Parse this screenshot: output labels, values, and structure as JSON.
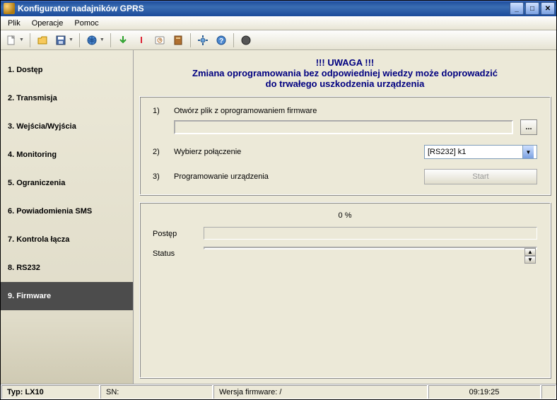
{
  "window": {
    "title": "Konfigurator nadajników GPRS"
  },
  "menu": {
    "file": "Plik",
    "operations": "Operacje",
    "help": "Pomoc"
  },
  "sidebar": {
    "items": [
      {
        "label": "1. Dostęp"
      },
      {
        "label": "2. Transmisja"
      },
      {
        "label": "3. Wejścia/Wyjścia"
      },
      {
        "label": "4. Monitoring"
      },
      {
        "label": "5. Ograniczenia"
      },
      {
        "label": "6. Powiadomienia SMS"
      },
      {
        "label": "7. Kontrola łącza"
      },
      {
        "label": "8. RS232"
      },
      {
        "label": "9. Firmware"
      }
    ],
    "active_index": 8
  },
  "warning": {
    "heading": "!!! UWAGA !!!",
    "line1": "Zmiana oprogramowania bez odpowiedniej wiedzy może doprowadzić",
    "line2": "do trwałego uszkodzenia urządzenia"
  },
  "steps": {
    "s1n": "1)",
    "s1l": "Otwórz plik z oprogramowaniem firmware",
    "path": "",
    "browse": "...",
    "s2n": "2)",
    "s2l": "Wybierz połączenie",
    "connection": "[RS232] k1",
    "s3n": "3)",
    "s3l": "Programowanie urządzenia",
    "start": "Start"
  },
  "progress": {
    "pct": "0 %",
    "progress_label": "Postęp",
    "status_label": "Status",
    "status_text": ""
  },
  "statusbar": {
    "type": "Typ: LX10",
    "sn": "SN:",
    "fw": "Wersja firmware: /",
    "time": "09:19:25"
  },
  "colors": {
    "accent": "#000080",
    "bg": "#ece9d8"
  }
}
